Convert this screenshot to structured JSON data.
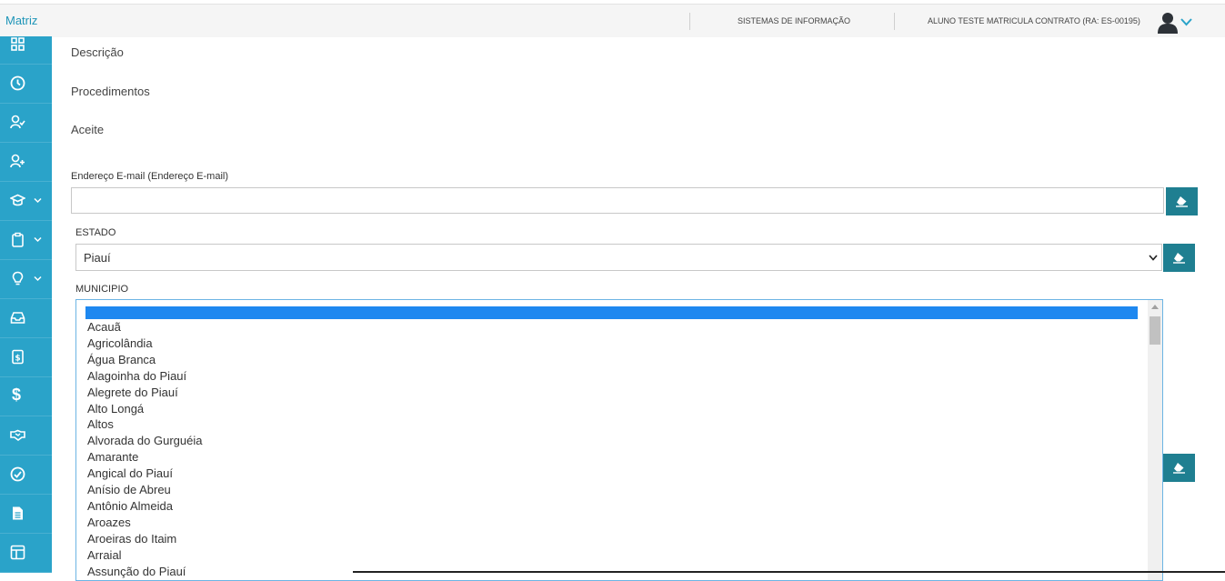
{
  "header": {
    "brand": "Matriz",
    "system_label": "SISTEMAS DE INFORMAÇÃO",
    "user_label": "ALUNO TESTE MATRICULA CONTRATO (RA: ES-00195)"
  },
  "sidebar": {
    "items": [
      {
        "icon": "dashboard-icon"
      },
      {
        "icon": "clock-icon"
      },
      {
        "icon": "user-check-icon"
      },
      {
        "icon": "user-add-icon"
      },
      {
        "icon": "graduation-cap-icon",
        "has_caret": true
      },
      {
        "icon": "clipboard-icon",
        "has_caret": true
      },
      {
        "icon": "lightbulb-icon",
        "has_caret": true
      },
      {
        "icon": "inbox-icon"
      },
      {
        "icon": "invoice-dollar-icon"
      },
      {
        "icon": "dollar-icon",
        "text": "$"
      },
      {
        "icon": "handshake-icon"
      },
      {
        "icon": "check-circle-icon"
      },
      {
        "icon": "document-icon"
      },
      {
        "icon": "layout-icon"
      }
    ]
  },
  "sections": {
    "descricao": "Descrição",
    "procedimentos": "Procedimentos",
    "aceite": "Aceite"
  },
  "form": {
    "email_label": "Endereço E-mail (Endereço E-mail)",
    "email_value": "",
    "estado_label": "ESTADO",
    "estado_value": "Piauí",
    "municipio_label": "MUNICIPIO",
    "municipio_options": [
      "Acauã",
      "Agricolândia",
      "Água Branca",
      "Alagoinha do Piauí",
      "Alegrete do Piauí",
      "Alto Longá",
      "Altos",
      "Alvorada do Gurguéia",
      "Amarante",
      "Angical do Piauí",
      "Anísio de Abreu",
      "Antônio Almeida",
      "Aroazes",
      "Aroeiras do Itaim",
      "Arraial",
      "Assunção do Piauí"
    ]
  },
  "colors": {
    "sidebar": "#2aa3c9",
    "button": "#1f7f91",
    "selected_option": "#1e88f0",
    "brand": "#1e95b8"
  }
}
